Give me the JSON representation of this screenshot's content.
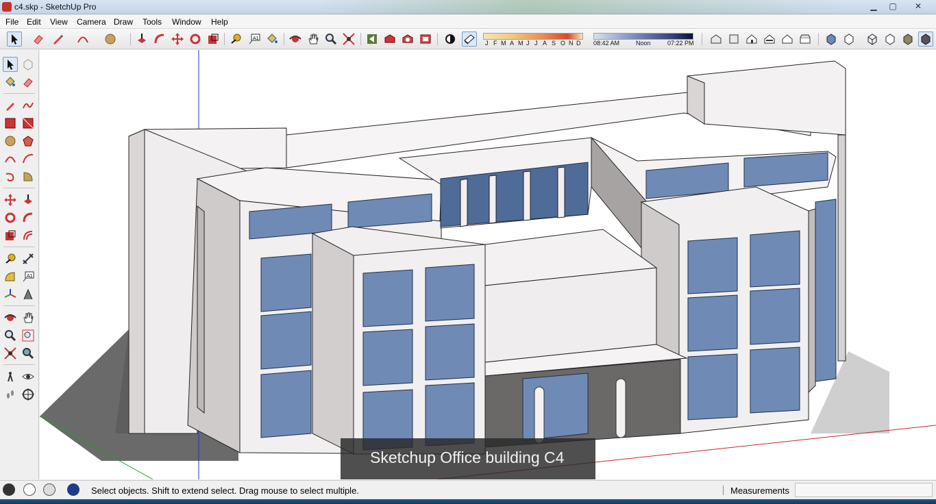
{
  "window": {
    "title": "c4.skp - SketchUp Pro",
    "min_glyph": "▁",
    "max_glyph": "▢",
    "close_glyph": "✕"
  },
  "menu": {
    "items": [
      "File",
      "Edit",
      "View",
      "Camera",
      "Draw",
      "Tools",
      "Window",
      "Help"
    ]
  },
  "shadow_settings": {
    "months": [
      "J",
      "F",
      "M",
      "A",
      "M",
      "J",
      "J",
      "A",
      "S",
      "O",
      "N",
      "D"
    ],
    "time_start": "08:42 AM",
    "time_mid": "Noon",
    "time_end": "07:22 PM"
  },
  "viewport": {
    "caption": "Sketchup Office building C4",
    "colors": {
      "wall_light": "#f3f1f1",
      "wall_shade": "#d3d0cf",
      "wall_dark": "#a9a6a5",
      "glass": "#6f8bb5",
      "glass_dark": "#3d5680",
      "ground_shadow": "#6c6c6c",
      "axis_red": "#c0282d",
      "axis_green": "#2c9a34",
      "axis_blue": "#1f2bd8"
    }
  },
  "statusbar": {
    "message": "Select objects. Shift to extend select. Drag mouse to select multiple.",
    "measurements_label": "Measurements",
    "measurements_value": ""
  }
}
